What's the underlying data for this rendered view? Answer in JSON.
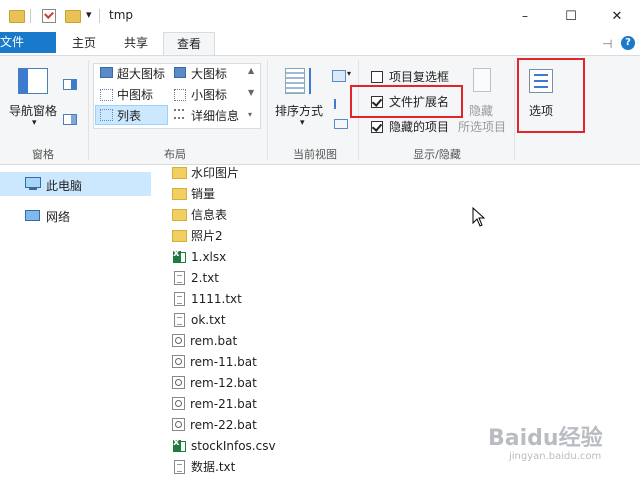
{
  "window": {
    "title": "tmp",
    "controls": {
      "minimize": "–",
      "maximize": "☐",
      "close": "✕"
    },
    "qa_dropdown": "▾"
  },
  "tabs": [
    {
      "label": "文件",
      "type": "file"
    },
    {
      "label": "主页"
    },
    {
      "label": "共享"
    },
    {
      "label": "查看",
      "active": true
    }
  ],
  "ribbon": {
    "groups": {
      "pane": "窗格",
      "layout": "布局",
      "current_view": "当前视图",
      "show_hide": "显示/隐藏"
    },
    "nav_pane_button": "导航窗格",
    "layout_items": {
      "extra_large_icons": "超大图标",
      "large_icons": "大图标",
      "medium_icons": "中图标",
      "small_icons": "小图标",
      "list": "列表",
      "details": "详细信息"
    },
    "sort_button": "排序方式",
    "item_checkboxes": {
      "label": "项目复选框",
      "checked": false
    },
    "file_extensions": {
      "label": "文件扩展名",
      "checked": true
    },
    "hidden_items": {
      "label": "隐藏的项目",
      "checked": true
    },
    "hide_selected": {
      "line1": "隐藏",
      "line2": "所选项目"
    },
    "options_button": "选项"
  },
  "nav": {
    "items": [
      {
        "label": "此电脑",
        "selected": true
      },
      {
        "label": "网络"
      }
    ]
  },
  "files": [
    {
      "name": "水印图片",
      "type": "folder"
    },
    {
      "name": "销量",
      "type": "folder"
    },
    {
      "name": "信息表",
      "type": "folder"
    },
    {
      "name": "照片2",
      "type": "folder"
    },
    {
      "name": "1.xlsx",
      "type": "excel"
    },
    {
      "name": "2.txt",
      "type": "txt"
    },
    {
      "name": "1111.txt",
      "type": "txt"
    },
    {
      "name": "ok.txt",
      "type": "txt"
    },
    {
      "name": "rem.bat",
      "type": "bat"
    },
    {
      "name": "rem-11.bat",
      "type": "bat"
    },
    {
      "name": "rem-12.bat",
      "type": "bat"
    },
    {
      "name": "rem-21.bat",
      "type": "bat"
    },
    {
      "name": "rem-22.bat",
      "type": "bat"
    },
    {
      "name": "stockInfos.csv",
      "type": "excel"
    },
    {
      "name": "数据.txt",
      "type": "txt"
    }
  ],
  "watermark": {
    "brand": "Baidu经验",
    "url": "jingyan.baidu.com"
  },
  "colors": {
    "file_tab": "#1979ca",
    "highlight_box": "#e0262b",
    "nav_selected": "#cce8ff"
  }
}
